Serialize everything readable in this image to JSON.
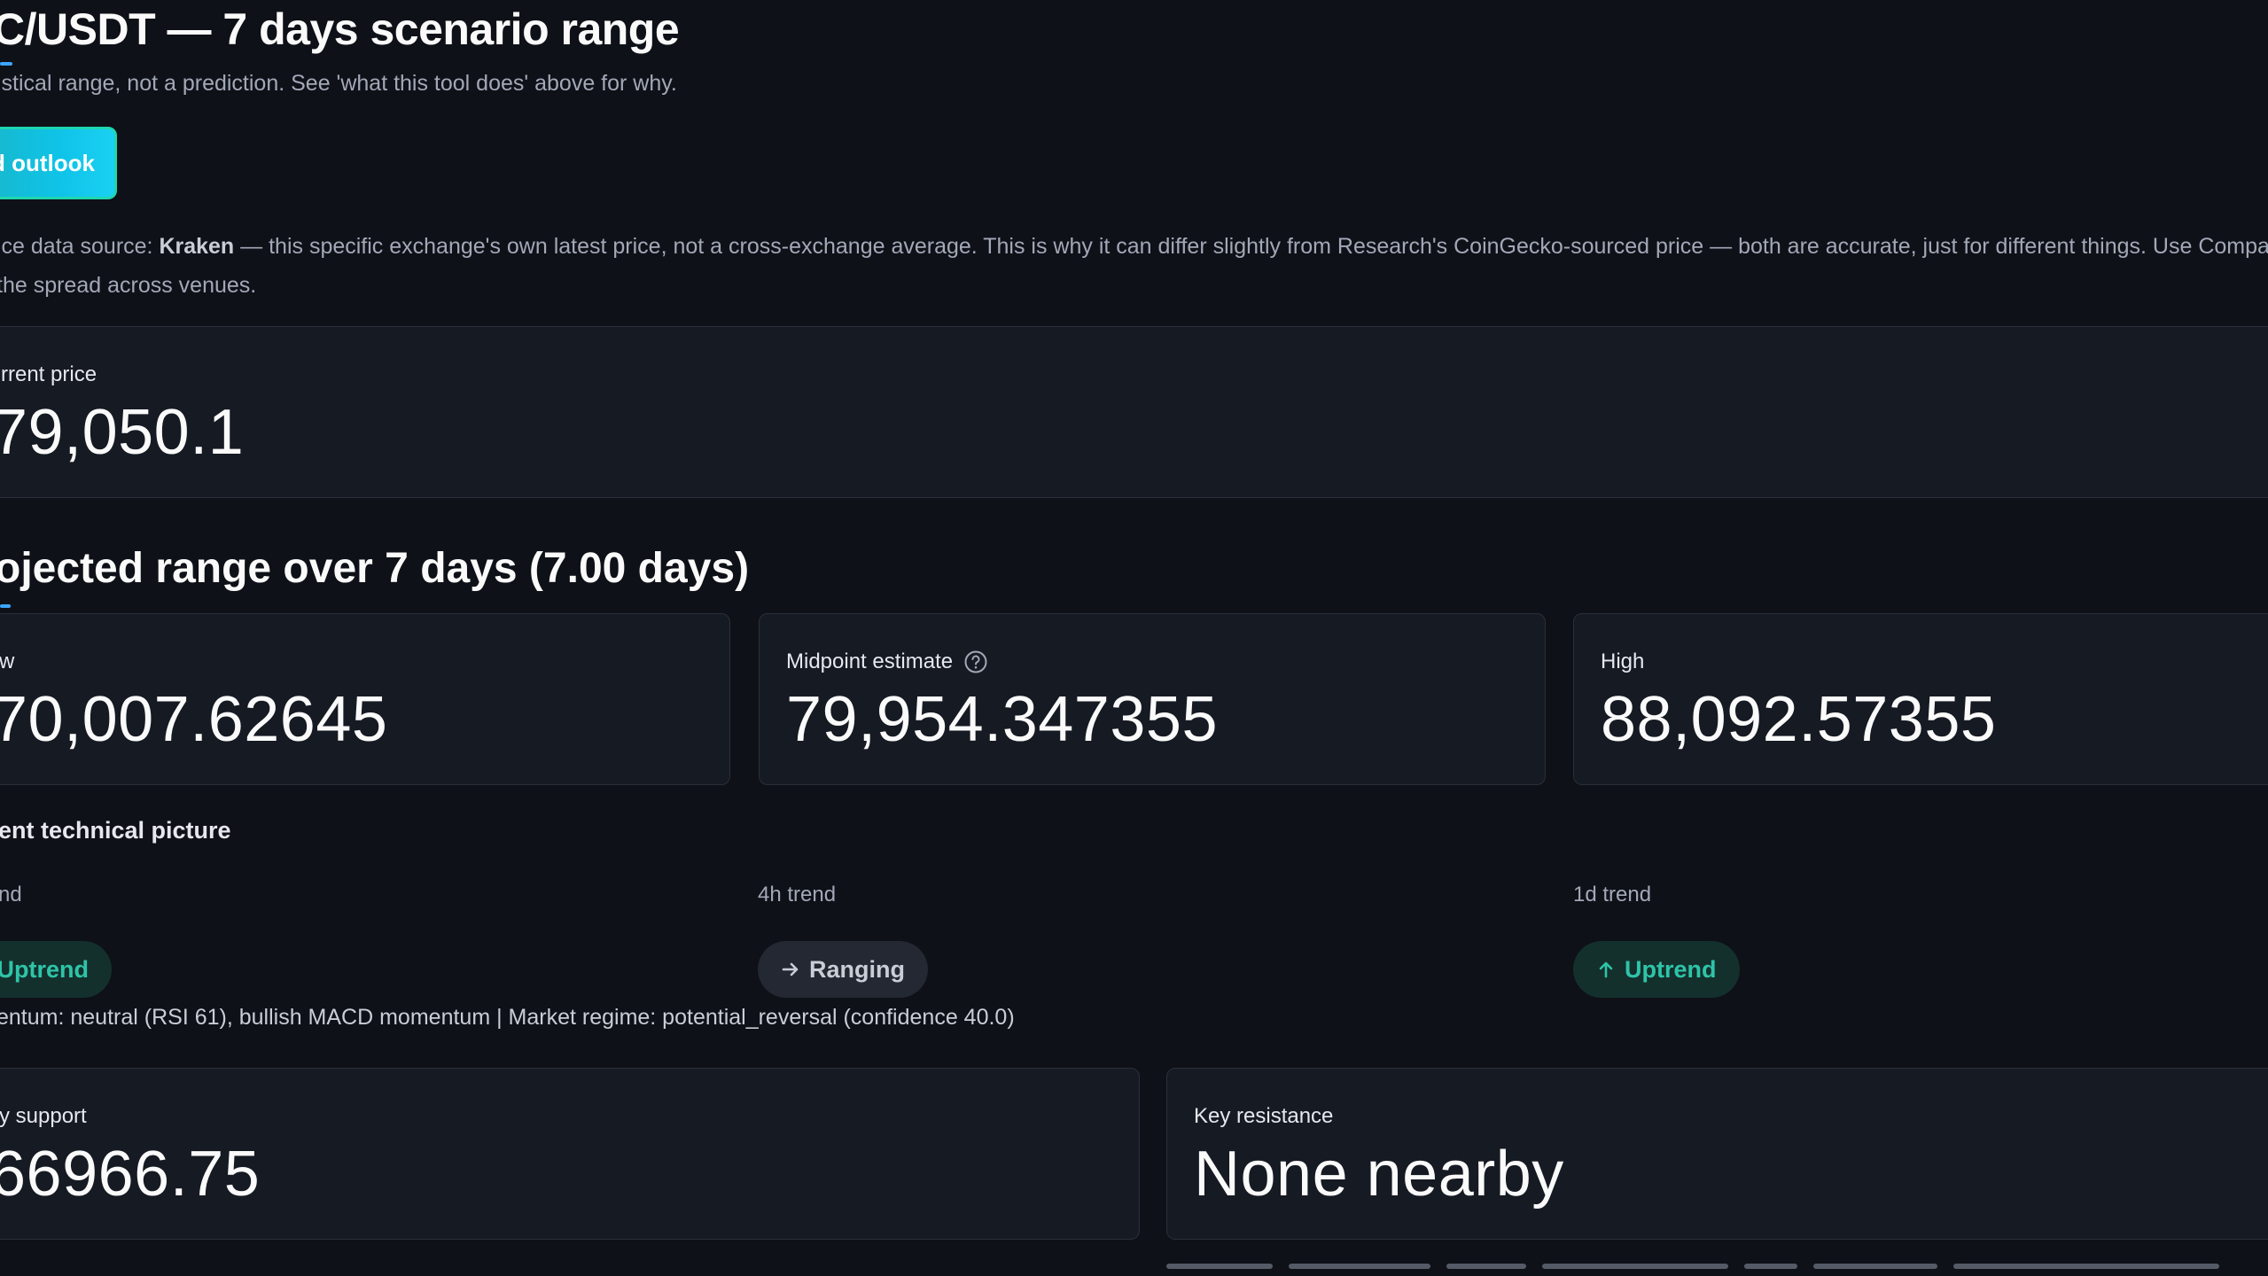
{
  "header": {
    "title": "C/USDT — 7 days scenario range",
    "subtitle": "istical range, not a prediction. See 'what this tool does' above for why.",
    "button_label": "d outlook"
  },
  "source_note": {
    "prefix": "ice data source: ",
    "exchange": "Kraken",
    "line1_rest": " — this specific exchange's own latest price, not a cross-exchange average. This is why it can differ slightly from Research's CoinGecko-sourced price — both are accurate, just for different things. Use Compare Exc",
    "line2": " the spread across venues."
  },
  "current_price": {
    "label": "rrent price",
    "value": "79,050.1"
  },
  "projected": {
    "heading": "ojected range over 7 days (7.00 days)",
    "low": {
      "label": "w",
      "value": "70,007.62645"
    },
    "mid": {
      "label": "Midpoint estimate",
      "value": "79,954.347355"
    },
    "high": {
      "label": "High",
      "value": "88,092.57355"
    }
  },
  "technical": {
    "title": "ent technical picture",
    "trends": [
      {
        "label": "nd",
        "status": "Uptrend",
        "kind": "up"
      },
      {
        "label": "4h trend",
        "status": "Ranging",
        "kind": "range"
      },
      {
        "label": "1d trend",
        "status": "Uptrend",
        "kind": "up"
      }
    ],
    "momentum": "entum: neutral (RSI 61), bullish MACD momentum | Market regime: potential_reversal (confidence 40.0)"
  },
  "levels": {
    "support": {
      "label": "y support",
      "value": "66966.75"
    },
    "resistance": {
      "label": "Key resistance",
      "value": "None nearby"
    }
  },
  "colors": {
    "background": "#0e1117",
    "card": "#161a23",
    "accent": "#3da5ff",
    "uptrend": "#2ec4a8",
    "button": "#0fc3e8"
  },
  "icons": {
    "help": "help-circle-icon",
    "arrow_up": "arrow-up-icon",
    "arrow_right": "arrow-right-icon"
  }
}
